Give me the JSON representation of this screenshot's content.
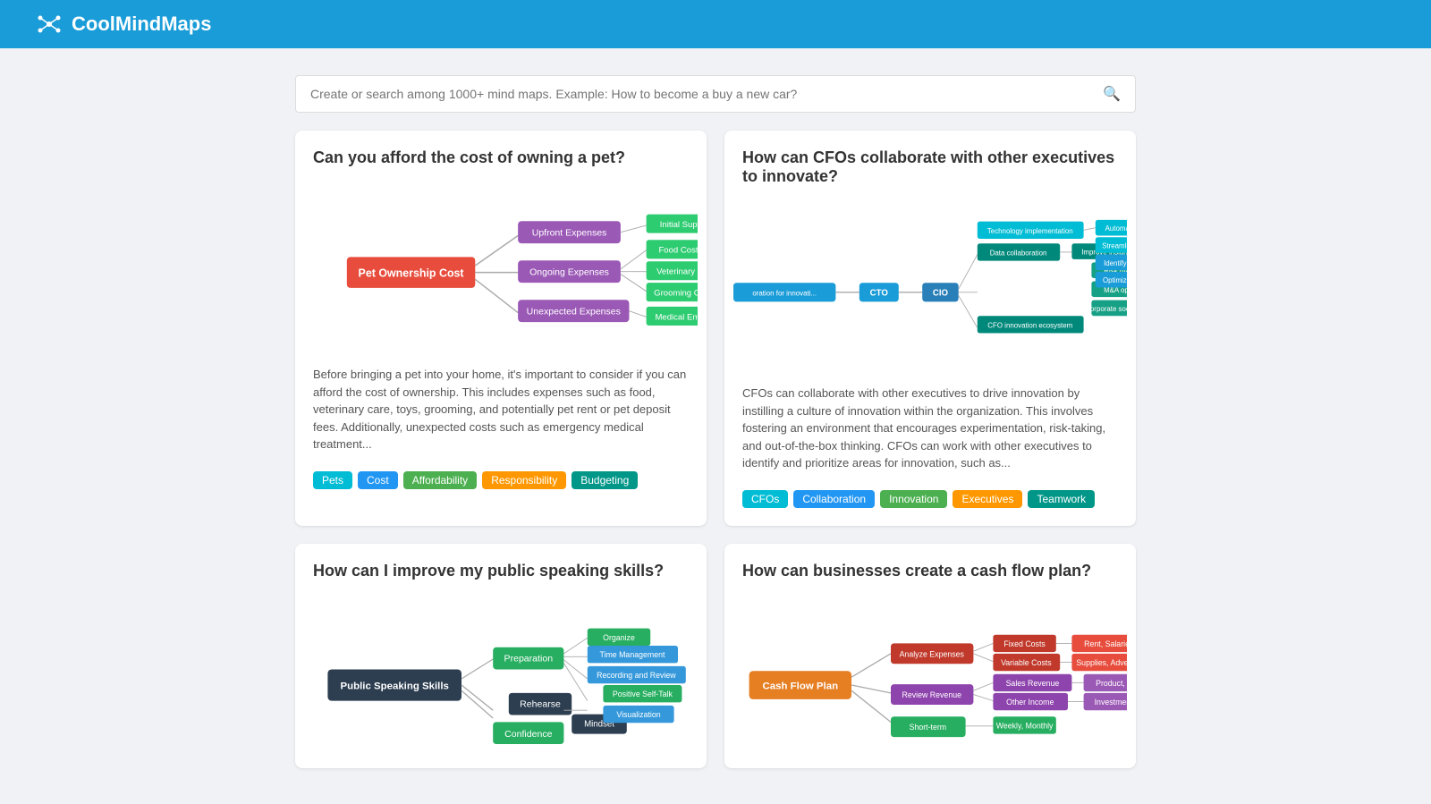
{
  "header": {
    "logo_text": "CoolMindMaps",
    "logo_icon": "🕸"
  },
  "search": {
    "placeholder": "Create or search among 1000+ mind maps. Example: How to become a buy a new car?"
  },
  "cards": [
    {
      "id": "pet",
      "title": "Can you afford the cost of owning a pet?",
      "description": "Before bringing a pet into your home, it's important to consider if you can afford the cost of ownership. This includes expenses such as food, veterinary care, toys, grooming, and potentially pet rent or pet deposit fees. Additionally, unexpected costs such as emergency medical treatment...",
      "tags": [
        {
          "label": "Pets",
          "color": "tag-cyan"
        },
        {
          "label": "Cost",
          "color": "tag-blue"
        },
        {
          "label": "Affordability",
          "color": "tag-green"
        },
        {
          "label": "Responsibility",
          "color": "tag-orange"
        },
        {
          "label": "Budgeting",
          "color": "tag-teal"
        }
      ]
    },
    {
      "id": "cfo",
      "title": "How can CFOs collaborate with other executives to innovate?",
      "description": "CFOs can collaborate with other executives to drive innovation by instilling a culture of innovation within the organization. This involves fostering an environment that encourages experimentation, risk-taking, and out-of-the-box thinking. CFOs can work with other executives to identify and prioritize areas for innovation, such as...",
      "tags": [
        {
          "label": "CFOs",
          "color": "tag-cyan"
        },
        {
          "label": "Collaboration",
          "color": "tag-blue"
        },
        {
          "label": "Innovation",
          "color": "tag-green"
        },
        {
          "label": "Executives",
          "color": "tag-orange"
        },
        {
          "label": "Teamwork",
          "color": "tag-teal"
        }
      ]
    },
    {
      "id": "speaking",
      "title": "How can I improve my public speaking skills?",
      "description": "",
      "tags": []
    },
    {
      "id": "cashflow",
      "title": "How can businesses create a cash flow plan?",
      "description": "",
      "tags": []
    }
  ]
}
